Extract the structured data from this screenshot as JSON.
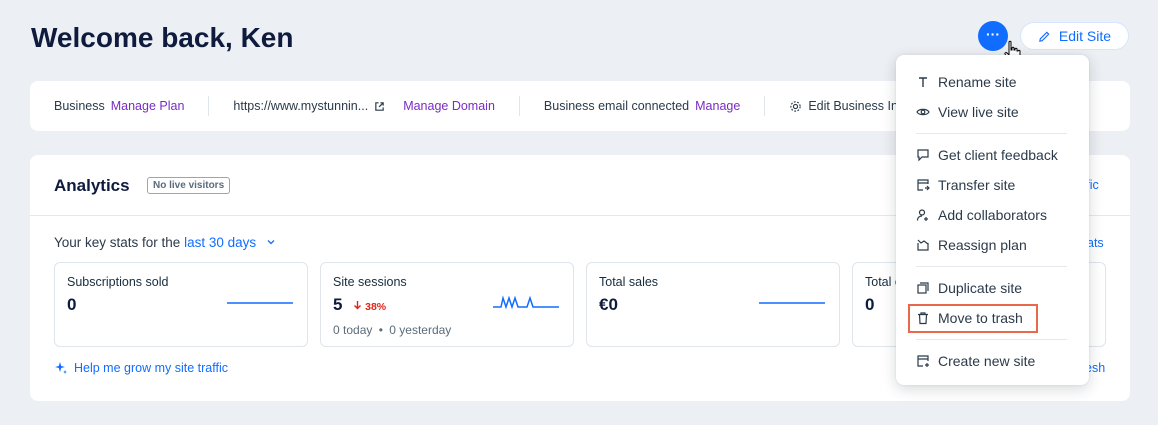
{
  "header": {
    "title": "Welcome back, Ken",
    "more_label": "···",
    "edit_site_label": "Edit Site"
  },
  "info_bar": {
    "plan_label": "Business",
    "manage_plan": "Manage Plan",
    "domain": "https://www.mystunnin...",
    "manage_domain": "Manage Domain",
    "email_label": "Business email connected",
    "manage_email": "Manage",
    "edit_business": "Edit Business Inf"
  },
  "analytics": {
    "title": "Analytics",
    "badge": "No live visitors",
    "key_stats_prefix": "Your key stats for the",
    "key_stats_period": "last 30 days",
    "stats": [
      {
        "label": "Subscriptions sold",
        "value": "0",
        "change": "",
        "sub_today": "",
        "sub_yesterday": ""
      },
      {
        "label": "Site sessions",
        "value": "5",
        "change": "38%",
        "sub_today": "0 today",
        "sub_yesterday": "0 yesterday"
      },
      {
        "label": "Total sales",
        "value": "€0",
        "change": "",
        "sub_today": "",
        "sub_yesterday": ""
      },
      {
        "label": "Total o",
        "value": "0",
        "change": "",
        "sub_today": "",
        "sub_yesterday": ""
      }
    ],
    "help_link": "Help me grow my site traffic",
    "peek_traffic": "ffic",
    "peek_stats": "ats",
    "peek_refresh": "esh"
  },
  "menu": {
    "items": [
      {
        "label": "Rename site",
        "icon": "text-icon"
      },
      {
        "label": "View live site",
        "icon": "eye-icon"
      },
      {
        "label": "Get client feedback",
        "icon": "comment-icon"
      },
      {
        "label": "Transfer site",
        "icon": "transfer-icon"
      },
      {
        "label": "Add collaborators",
        "icon": "add-user-icon"
      },
      {
        "label": "Reassign plan",
        "icon": "reassign-icon"
      },
      {
        "label": "Duplicate site",
        "icon": "duplicate-icon"
      },
      {
        "label": "Move to trash",
        "icon": "trash-icon"
      },
      {
        "label": "Create new site",
        "icon": "new-site-icon"
      }
    ]
  },
  "colors": {
    "accent": "#116dff",
    "link_purple": "#7a2cc3",
    "negative": "#e62214",
    "highlight": "#e8694a"
  }
}
